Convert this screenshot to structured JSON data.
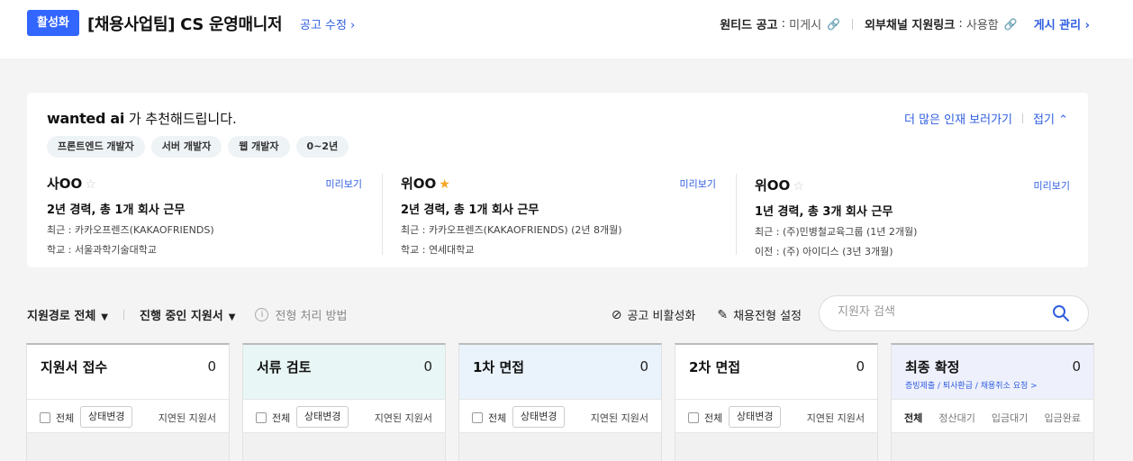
{
  "header": {
    "status_badge": "활성화",
    "job_title": "[채용사업팀] CS 운영매니저",
    "edit_link": "공고 수정",
    "wanted_label": "원티드 공고",
    "wanted_value": "미게시",
    "external_label": "외부채널 지원링크",
    "external_value": "사용함",
    "manage_link": "게시 관리"
  },
  "recommend": {
    "logo_text": "wanted ai",
    "heading": "가 추천해드립니다.",
    "more_link": "더 많은 인재 보러가기",
    "fold_link": "접기",
    "tags": [
      "프론트엔드 개발자",
      "서버 개발자",
      "웹 개발자",
      "0~2년"
    ],
    "candidates": [
      {
        "name": "사OO",
        "star": "☆",
        "star_color": "#cccccc",
        "preview": "미리보기",
        "career": "2년 경력, 총 1개 회사 근무",
        "line1": "최근 : 카카오프렌즈(KAKAOFRIENDS)",
        "line2": "학교 : 서울과학기술대학교"
      },
      {
        "name": "위OO",
        "star": "★",
        "star_color": "#f5a623",
        "preview": "미리보기",
        "career": "2년 경력, 총 1개 회사 근무",
        "line1": "최근 : 카카오프렌즈(KAKAOFRIENDS) (2년 8개월)",
        "line2": "학교 : 연세대학교"
      },
      {
        "name": "위OO",
        "star": "☆",
        "star_color": "#cccccc",
        "preview": "미리보기",
        "career": "1년 경력, 총 3개 회사 근무",
        "line1": "최근 : (주)민병철교육그룹 (1년 2개월)",
        "line2": "이전 :  (주) 아이디스 (3년 3개월)"
      }
    ]
  },
  "filters": {
    "route": "지원경로 전체",
    "progress": "진행 중인 지원서",
    "process_help": "전형 처리 방법",
    "deactivate": "공고 비활성화",
    "settings": "채용전형 설정",
    "search_placeholder": "지원자 검색"
  },
  "columns": [
    {
      "title": "지원서 접수",
      "count": "0",
      "color": "#ffffff",
      "all": "전체",
      "status_btn": "상태변경",
      "late": "지연된 지원서"
    },
    {
      "title": "서류 검토",
      "count": "0",
      "color": "#e8f7f5",
      "all": "전체",
      "status_btn": "상태변경",
      "late": "지연된 지원서"
    },
    {
      "title": "1차 면접",
      "count": "0",
      "color": "#eaf3fc",
      "all": "전체",
      "status_btn": "상태변경",
      "late": "지연된 지원서"
    },
    {
      "title": "2차 면접",
      "count": "0",
      "color": "#ffffff",
      "all": "전체",
      "status_btn": "상태변경",
      "late": "지연된 지원서"
    },
    {
      "title": "최종 확정",
      "count": "0",
      "color": "#eef0fb",
      "sub": "증빙제출 / 퇴사환급 / 채용취소 요청 >",
      "tabs": [
        "전체",
        "정산대기",
        "입금대기",
        "입금완료"
      ]
    }
  ]
}
